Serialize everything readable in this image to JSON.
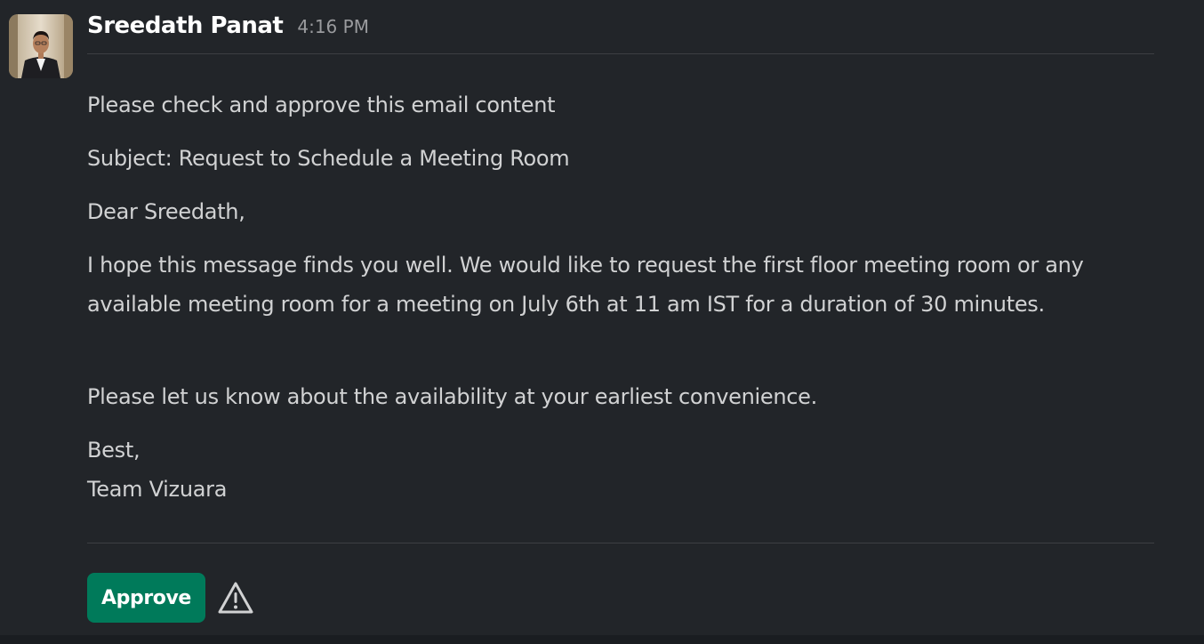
{
  "message": {
    "sender": "Sreedath Panat",
    "timestamp": "4:16 PM",
    "avatar_icon": "user-avatar-photo",
    "paragraphs": {
      "intro": "Please check and approve this email content",
      "subject": "Subject: Request to Schedule a Meeting Room",
      "greeting": "Dear Sreedath,",
      "body": "I hope this message finds you well. We would like to request the first floor meeting room or any available meeting room for a meeting on July 6th at 11 am IST for a duration of 30 minutes.",
      "availability": "Please let us know about the availability at your earliest convenience.",
      "signoff": "Best,",
      "signature": "Team Vizuara"
    }
  },
  "actions": {
    "approve_label": "Approve",
    "warning_icon": "warning-triangle-icon"
  },
  "colors": {
    "background": "#222529",
    "approve_button": "#007a5a",
    "text": "#d1d2d3",
    "sender": "#ffffff",
    "timestamp": "#9a9b9e"
  }
}
